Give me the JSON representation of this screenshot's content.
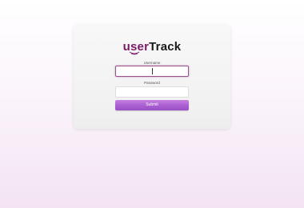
{
  "brand": {
    "prefix": "user",
    "suffix": "Track",
    "prefix_color": "#7a1a66"
  },
  "login_form": {
    "username_label": "Username",
    "username_value": "",
    "password_label": "Password",
    "password_value": "",
    "submit_label": "Submit",
    "accent_color": "#a95ed1"
  }
}
